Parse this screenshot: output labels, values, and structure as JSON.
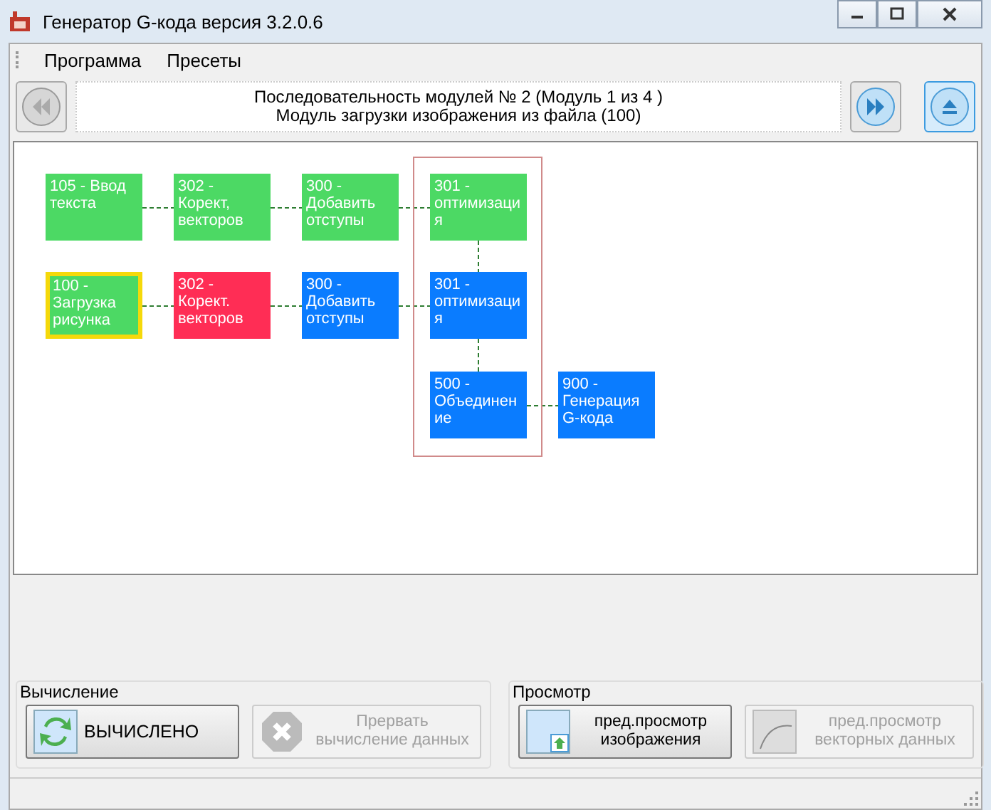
{
  "window": {
    "title": "Генератор G-кода версия 3.2.0.6"
  },
  "menu": [
    {
      "label": "Программа"
    },
    {
      "label": "Пресеты"
    }
  ],
  "toolbar": {
    "back_disabled": true,
    "info_lines": [
      "Последовательность модулей № 2 (Модуль 1 из 4 )",
      "Модуль загрузки изображения из файла (100)"
    ],
    "forward_disabled": false,
    "eject_selected": true
  },
  "modules": [
    {
      "label": "105 - Ввод\nтекста",
      "color": "#4cd964",
      "selected": false
    },
    {
      "label": "302 -\nКорект,\nвекторов",
      "color": "#4cd964",
      "selected": false
    },
    {
      "label": "300 -\nДобавить\nотступы",
      "color": "#4cd964",
      "selected": false
    },
    {
      "label": "301 -\nоптимизаци\nя",
      "color": "#4cd964",
      "selected": false
    },
    {
      "label": "100 -\nЗагрузка\nрисунка",
      "color": "#4cd964",
      "selected": true
    },
    {
      "label": "302 -\nКорект.\nвекторов",
      "color": "#ff2d55",
      "selected": false
    },
    {
      "label": "300 -\nДобавить\nотступы",
      "color": "#0a7cff",
      "selected": false
    },
    {
      "label": "301 -\nоптимизаци\nя",
      "color": "#0a7cff",
      "selected": false
    },
    {
      "label": "500 -\nОбъединен\nие",
      "color": "#0a7cff",
      "selected": false
    },
    {
      "label": "900 -\nГенерация\nG-кода",
      "color": "#0a7cff",
      "selected": false
    }
  ],
  "groups": [
    {
      "title": "Вычисление",
      "buttons": [
        {
          "label": "ВЫЧИСЛЕНО",
          "kind": "compute",
          "disabled": false
        },
        {
          "label": "Прервать вычисление данных",
          "kind": "stop",
          "disabled": true
        }
      ]
    },
    {
      "title": "Просмотр",
      "buttons": [
        {
          "label": "пред.просмотр изображения",
          "kind": "image",
          "disabled": false
        },
        {
          "label": "пред.просмотр векторных данных",
          "kind": "vector",
          "disabled": true
        }
      ]
    }
  ]
}
